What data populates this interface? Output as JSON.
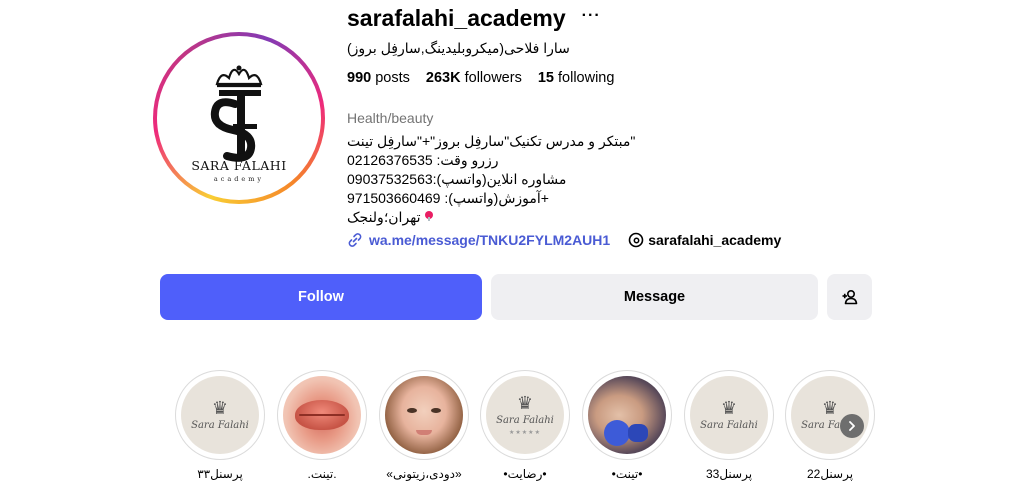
{
  "profile": {
    "username": "sarafalahi_academy",
    "more_label": "···",
    "full_name": "سارا فلاحی(میکروبلیدینگ,سارفِل بروز)",
    "avatar_text_name": "SARA FALAHI",
    "avatar_text_sub": "academy",
    "stats": {
      "posts_count": "990",
      "posts_label": "posts",
      "followers_count": "263K",
      "followers_label": "followers",
      "following_count": "15",
      "following_label": "following"
    },
    "category": "Health/beauty",
    "bio_lines": [
      "مبتکر و مدرس تکنیک\"سارفِل بروز\"+\"سارفِل تینت\"",
      "رزرو وقت: 02126376535",
      "مشاوره انلاین(واتسپ):09037532563",
      "آموزش(واتسپ): 971503660469+",
      "تهران؛ولنجک"
    ],
    "link_url": "wa.me/message/TNKU2FYLM2AUH1",
    "threads_handle": "sarafalahi_academy"
  },
  "actions": {
    "follow_label": "Follow",
    "message_label": "Message"
  },
  "highlights": [
    {
      "label": "پرسنل۳۳",
      "type": "logo"
    },
    {
      "label": ".تینت.",
      "type": "lips"
    },
    {
      "label": "«دودی،زیتونی»",
      "type": "face"
    },
    {
      "label": "•رضایت•",
      "type": "logo-stars"
    },
    {
      "label": "•تینت•",
      "type": "procedure"
    },
    {
      "label": "پرسنل33",
      "type": "logo"
    },
    {
      "label": "پرسنل22",
      "type": "logo"
    }
  ],
  "colors": {
    "follow_button": "#4f5ffa",
    "secondary_button": "#efeff2",
    "link": "#4a5bd4",
    "category_text": "#737373"
  }
}
